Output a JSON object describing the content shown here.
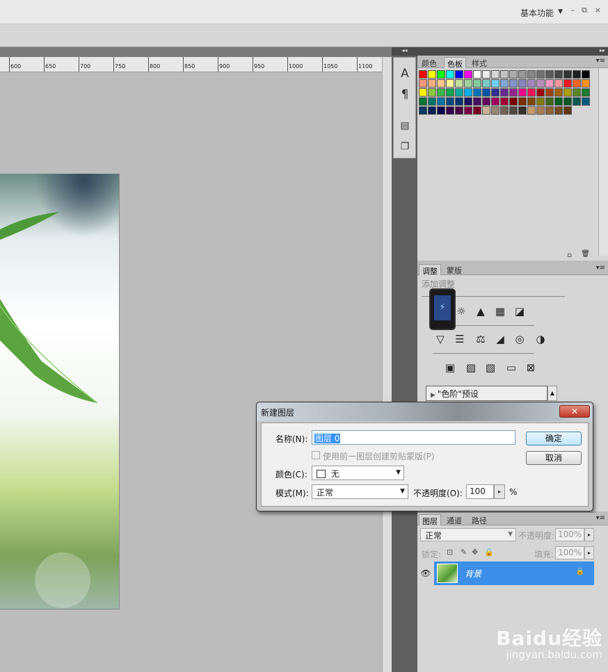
{
  "topbar": {
    "workspace_label": "基本功能",
    "dropdown_icon": "chevron-down-icon",
    "minimize": "–",
    "restore": "⧉",
    "close": "×"
  },
  "ruler": {
    "ticks": [
      "600",
      "650",
      "700",
      "750",
      "800",
      "850",
      "900",
      "950",
      "1000",
      "1050",
      "1100"
    ]
  },
  "iconstrip": {
    "collapse": "◂◂",
    "icons": [
      "character-icon",
      "paragraph-icon",
      "layer-comps-icon",
      "clone-source-icon"
    ]
  },
  "swatches_panel": {
    "tabs": [
      "颜色",
      "色板",
      "样式"
    ],
    "active_tab": "色板",
    "colors": [
      "#ff0000",
      "#ffff00",
      "#00ff00",
      "#00ffff",
      "#0000ff",
      "#ff00ff",
      "#ffffff",
      "#ebebeb",
      "#d6d6d6",
      "#c2c2c2",
      "#adadad",
      "#999999",
      "#858585",
      "#707070",
      "#5c5c5c",
      "#474747",
      "#333333",
      "#1f1f1f",
      "#000000",
      "#f7977a",
      "#f9ad81",
      "#fdc68a",
      "#fff79a",
      "#c4df9b",
      "#a2d39c",
      "#82ca9d",
      "#7bcdc8",
      "#6ecff6",
      "#7ea7d8",
      "#8493ca",
      "#8882be",
      "#a187be",
      "#bc8dbf",
      "#f49ac2",
      "#f6989d",
      "#ed1c24",
      "#f26522",
      "#f7941d",
      "#fff200",
      "#8dc73f",
      "#39b54a",
      "#00a651",
      "#00a99d",
      "#00aeef",
      "#0072bc",
      "#0054a6",
      "#2e3192",
      "#662d91",
      "#92278f",
      "#ec008c",
      "#ed145b",
      "#9e0b0f",
      "#a0410d",
      "#a3620a",
      "#aba000",
      "#598527",
      "#197b30",
      "#007236",
      "#00746b",
      "#0076a3",
      "#004a80",
      "#003471",
      "#1b1464",
      "#440e62",
      "#630460",
      "#9e005d",
      "#9e0039",
      "#790000",
      "#7b2e00",
      "#7d4900",
      "#827b00",
      "#406618",
      "#005e20",
      "#005826",
      "#005952",
      "#005b7f",
      "#003663",
      "#002157",
      "#0d004c",
      "#32004b",
      "#4b0049",
      "#7b0046",
      "#7a0026",
      "#c7b299",
      "#998675",
      "#736357",
      "#534741",
      "#37302a",
      "#c69c6d",
      "#a67c52",
      "#8c6239",
      "#754c24",
      "#603913"
    ],
    "menu_icon": "panel-menu-icon"
  },
  "adjust_panel": {
    "tabs": [
      "调整",
      "蒙版"
    ],
    "active_tab": "调整",
    "title": "添加调整",
    "preset": "\"色阶\"预设",
    "icons_row1": [
      "☼",
      "▲",
      "▦",
      "◪"
    ],
    "icons_row2": [
      "▽",
      "☰",
      "⚖",
      "◢",
      "◎",
      "◑"
    ],
    "icons_row3": [
      "▣",
      "▨",
      "▧",
      "▭",
      "⊠"
    ]
  },
  "dialog": {
    "title": "新建图层",
    "close_label": "✕",
    "name_label": "名称(N):",
    "name_value": "图层 0",
    "clip_label": "使用前一图层创建剪贴蒙版(P)",
    "color_label": "颜色(C):",
    "color_value": "无",
    "mode_label": "模式(M):",
    "mode_value": "正常",
    "opacity_label": "不透明度(O):",
    "opacity_value": "100",
    "percent": "%",
    "ok_label": "确定",
    "cancel_label": "取消"
  },
  "layers_panel": {
    "tabs": [
      "图层",
      "通道",
      "路径"
    ],
    "active_tab": "图层",
    "blend_mode": "正常",
    "opacity_label": "不透明度:",
    "opacity_value": "100%",
    "lock_label": "锁定:",
    "fill_label": "填充:",
    "fill_value": "100%",
    "layer_name": "背景"
  },
  "watermark": {
    "logo": "Baidu经验",
    "url": "jingyan.baidu.com"
  }
}
